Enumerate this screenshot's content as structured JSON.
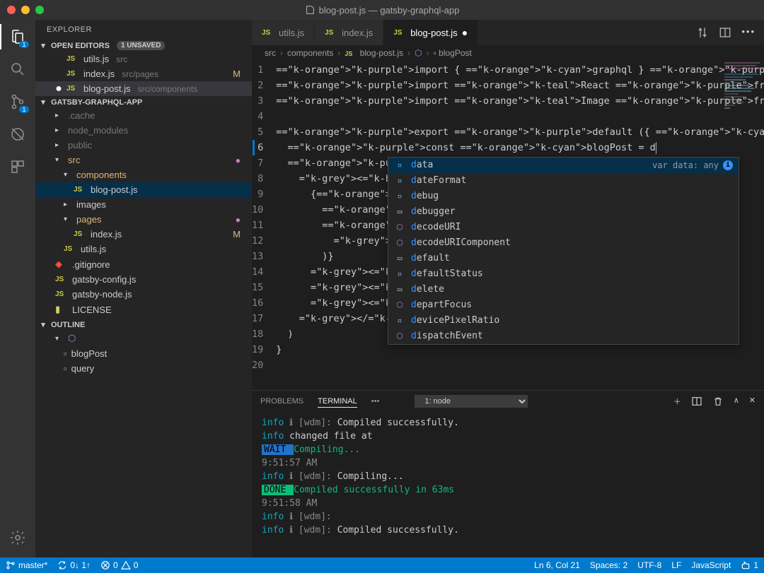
{
  "window": {
    "title": "blog-post.js — gatsby-graphql-app"
  },
  "activity": {
    "explorer_badge": "1",
    "scm_badge": "1"
  },
  "sidebar": {
    "title": "EXPLORER",
    "open_editors_label": "OPEN EDITORS",
    "unsaved_label": "1 UNSAVED",
    "open_editors": [
      {
        "name": "utils.js",
        "path": "src",
        "modified": ""
      },
      {
        "name": "index.js",
        "path": "src/pages",
        "modified": "M"
      },
      {
        "name": "blog-post.js",
        "path": "src/components",
        "modified": "",
        "dot": true,
        "active": true
      }
    ],
    "project_label": "GATSBY-GRAPHQL-APP",
    "tree": [
      {
        "t": "folder",
        "l": ".cache",
        "d": 0,
        "dim": true,
        "open": false
      },
      {
        "t": "folder",
        "l": "node_modules",
        "d": 0,
        "dim": true,
        "open": false
      },
      {
        "t": "folder",
        "l": "public",
        "d": 0,
        "dim": true,
        "open": false
      },
      {
        "t": "folder",
        "l": "src",
        "d": 0,
        "open": true,
        "dot": true
      },
      {
        "t": "folder",
        "l": "components",
        "d": 1,
        "open": true
      },
      {
        "t": "js",
        "l": "blog-post.js",
        "d": 2,
        "hl": true
      },
      {
        "t": "folder",
        "l": "images",
        "d": 1,
        "open": false
      },
      {
        "t": "folder",
        "l": "pages",
        "d": 1,
        "open": true,
        "dot": true
      },
      {
        "t": "js",
        "l": "index.js",
        "d": 2,
        "m": "M"
      },
      {
        "t": "js",
        "l": "utils.js",
        "d": 1
      },
      {
        "t": "file",
        "l": ".gitignore",
        "d": 0,
        "icon": "git"
      },
      {
        "t": "js",
        "l": "gatsby-config.js",
        "d": 0
      },
      {
        "t": "js",
        "l": "gatsby-node.js",
        "d": 0
      },
      {
        "t": "file",
        "l": "LICENSE",
        "d": 0,
        "icon": "lic"
      }
    ],
    "outline_label": "OUTLINE",
    "outline": [
      {
        "l": "<function>",
        "d": 0,
        "icon": "cube",
        "open": true
      },
      {
        "l": "blogPost",
        "d": 1,
        "icon": "var"
      },
      {
        "l": "query",
        "d": 1,
        "icon": "var"
      }
    ]
  },
  "tabs": [
    {
      "label": "utils.js",
      "active": false
    },
    {
      "label": "index.js",
      "active": false
    },
    {
      "label": "blog-post.js",
      "active": true,
      "modified": true
    }
  ],
  "breadcrumbs": [
    "src",
    "components",
    "blog-post.js",
    "<function>",
    "blogPost"
  ],
  "code": {
    "current_line": 6,
    "lines": [
      "import { graphql } from \"gatsby\"",
      "import React from \"react\"",
      "import Image from \"gatsby-image\"",
      "",
      "export default ({ data }) => {",
      "  const blogPost = d",
      "  return (",
      "    <div>",
      "      {blogP",
      "        blog",
      "        blog",
      "          <I",
      "        )}",
      "      <h1>{b",
      "      <div>P",
      "      <div d",
      "    </div>",
      "  )",
      "}",
      ""
    ]
  },
  "suggest": {
    "detail": "var data: any",
    "items": [
      {
        "l": "data",
        "k": "var",
        "sel": true
      },
      {
        "l": "dateFormat",
        "k": "var"
      },
      {
        "l": "debug",
        "k": "var"
      },
      {
        "l": "debugger",
        "k": "kw"
      },
      {
        "l": "decodeURI",
        "k": "func"
      },
      {
        "l": "decodeURIComponent",
        "k": "func"
      },
      {
        "l": "default",
        "k": "kw"
      },
      {
        "l": "defaultStatus",
        "k": "var"
      },
      {
        "l": "delete",
        "k": "kw"
      },
      {
        "l": "departFocus",
        "k": "func"
      },
      {
        "l": "devicePixelRatio",
        "k": "var"
      },
      {
        "l": "dispatchEvent",
        "k": "func"
      }
    ]
  },
  "panel": {
    "tabs": {
      "problems": "PROBLEMS",
      "terminal": "TERMINAL"
    },
    "select": "1: node",
    "lines": [
      {
        "seg": [
          [
            "info",
            "info"
          ],
          [
            "dim",
            " ℹ [wdm]: "
          ],
          [
            "",
            "Compiled successfully."
          ]
        ]
      },
      {
        "seg": [
          [
            "info u",
            "info"
          ],
          [
            "",
            " changed file at"
          ]
        ]
      },
      {
        "seg": [
          [
            "wait",
            " WAIT "
          ],
          [
            "green",
            "  Compiling..."
          ]
        ]
      },
      {
        "seg": [
          [
            "dim",
            "9:51:57 AM"
          ]
        ]
      },
      {
        "seg": [
          [
            "",
            ""
          ]
        ]
      },
      {
        "seg": [
          [
            "info",
            "info"
          ],
          [
            "dim",
            " ℹ [wdm]: "
          ],
          [
            "",
            "Compiling..."
          ]
        ]
      },
      {
        "seg": [
          [
            "done",
            " DONE "
          ],
          [
            "green",
            "  Compiled successfully in 63ms"
          ]
        ]
      },
      {
        "seg": [
          [
            "dim",
            "9:51:58 AM"
          ]
        ]
      },
      {
        "seg": [
          [
            "",
            ""
          ]
        ]
      },
      {
        "seg": [
          [
            "info",
            "info"
          ],
          [
            "dim",
            " ℹ [wdm]:"
          ]
        ]
      },
      {
        "seg": [
          [
            "info",
            "info"
          ],
          [
            "dim",
            " ℹ [wdm]: "
          ],
          [
            "",
            "Compiled successfully."
          ]
        ]
      }
    ]
  },
  "status": {
    "branch": "master*",
    "sync": "0↓ 1↑",
    "errors": "0",
    "warnings": "0",
    "cursor": "Ln 6, Col 21",
    "spaces": "Spaces: 2",
    "encoding": "UTF-8",
    "eol": "LF",
    "lang": "JavaScript",
    "feedback": "1"
  }
}
